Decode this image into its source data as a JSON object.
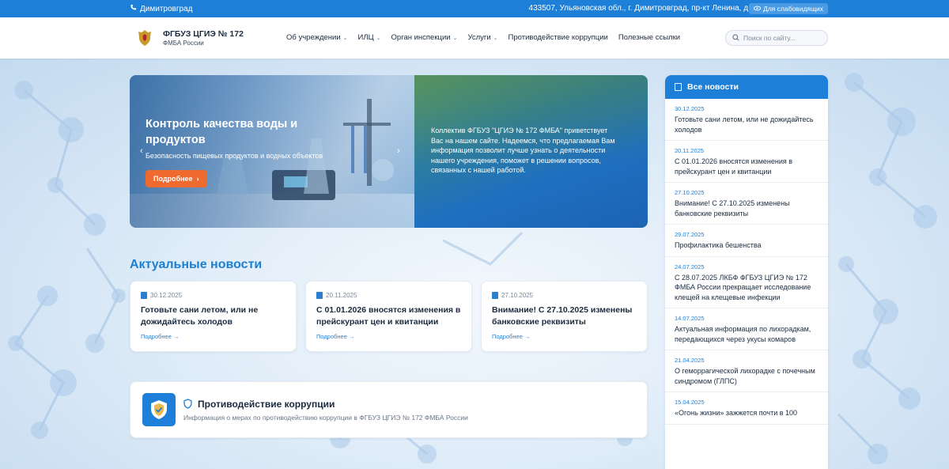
{
  "topbar": {
    "city": "Димитровград",
    "address": "433507, Ульяновская обл., г. Димитровград, пр-кт Ленина, д.1 к.г",
    "a11y_label": "Для слабовидящих"
  },
  "header": {
    "org_name": "ФГБУЗ ЦГИЭ № 172",
    "org_sub": "ФМБА России",
    "nav": [
      {
        "label": "Об учреждении",
        "dropdown": true
      },
      {
        "label": "ИЛЦ",
        "dropdown": true
      },
      {
        "label": "Орган инспекции",
        "dropdown": true
      },
      {
        "label": "Услуги",
        "dropdown": true
      },
      {
        "label": "Противодействие коррупции",
        "dropdown": false
      },
      {
        "label": "Полезные ссылки",
        "dropdown": false
      }
    ],
    "search_placeholder": "Поиск по сайту..."
  },
  "hero": {
    "title": "Контроль качества воды и продуктов",
    "subtitle": "Безопасность пищевых продуктов и водных объектов",
    "button_label": "Подробнее",
    "welcome_text": "Коллектив ФГБУЗ \"ЦГИЭ № 172 ФМБА\" приветствует Вас на нашем сайте. Надеемся, что предлагаемая Вам информация позволит лучше узнать о деятельности нашего учреждения, поможет в решении вопросов, связанных с нашей работой."
  },
  "news_section": {
    "title": "Актуальные новости",
    "cards": [
      {
        "date": "30.12.2025",
        "title": "Готовьте сани летом, или не дожидайтесь холодов",
        "more": "Подробнее →"
      },
      {
        "date": "20.11.2025",
        "title": "С 01.01.2026 вносятся изменения в прейскурант цен и квитанции",
        "more": "Подробнее →"
      },
      {
        "date": "27.10.2025",
        "title": "Внимание! С 27.10.2025 изменены банковские реквизиты",
        "more": "Подробнее →"
      }
    ]
  },
  "anticorruption": {
    "title": "Противодействие коррупции",
    "description": "Информация о мерах по противодействию коррупции в ФГБУЗ ЦГИЭ № 172 ФМБА России"
  },
  "sidebar": {
    "title": "Все новости",
    "items": [
      {
        "date": "30.12.2025",
        "title": "Готовьте сани летом, или не дожидайтесь холодов"
      },
      {
        "date": "20.11.2025",
        "title": "С 01.01.2026 вносятся изменения в прейскурант цен и квитанции"
      },
      {
        "date": "27.10.2025",
        "title": "Внимание! С 27.10.2025 изменены банковские реквизиты"
      },
      {
        "date": "29.07.2025",
        "title": "Профилактика бешенства"
      },
      {
        "date": "24.07.2025",
        "title": "С 28.07.2025 ЛКБФ ФГБУЗ ЦГИЭ № 172 ФМБА России прекращает исследование клещей на клещевые инфекции"
      },
      {
        "date": "14.07.2025",
        "title": "Актуальная информация по лихорадкам, передающихся через укусы комаров"
      },
      {
        "date": "21.04.2025",
        "title": "О геморрагической лихорадке с почечным синдромом (ГЛПС)"
      },
      {
        "date": "15.04.2025",
        "title": "«Огонь жизни» зажжется почти в 100"
      }
    ]
  },
  "colors": {
    "primary": "#1e7fd8",
    "accent_button": "#ef6a2f",
    "heading": "#1c7fcf"
  }
}
